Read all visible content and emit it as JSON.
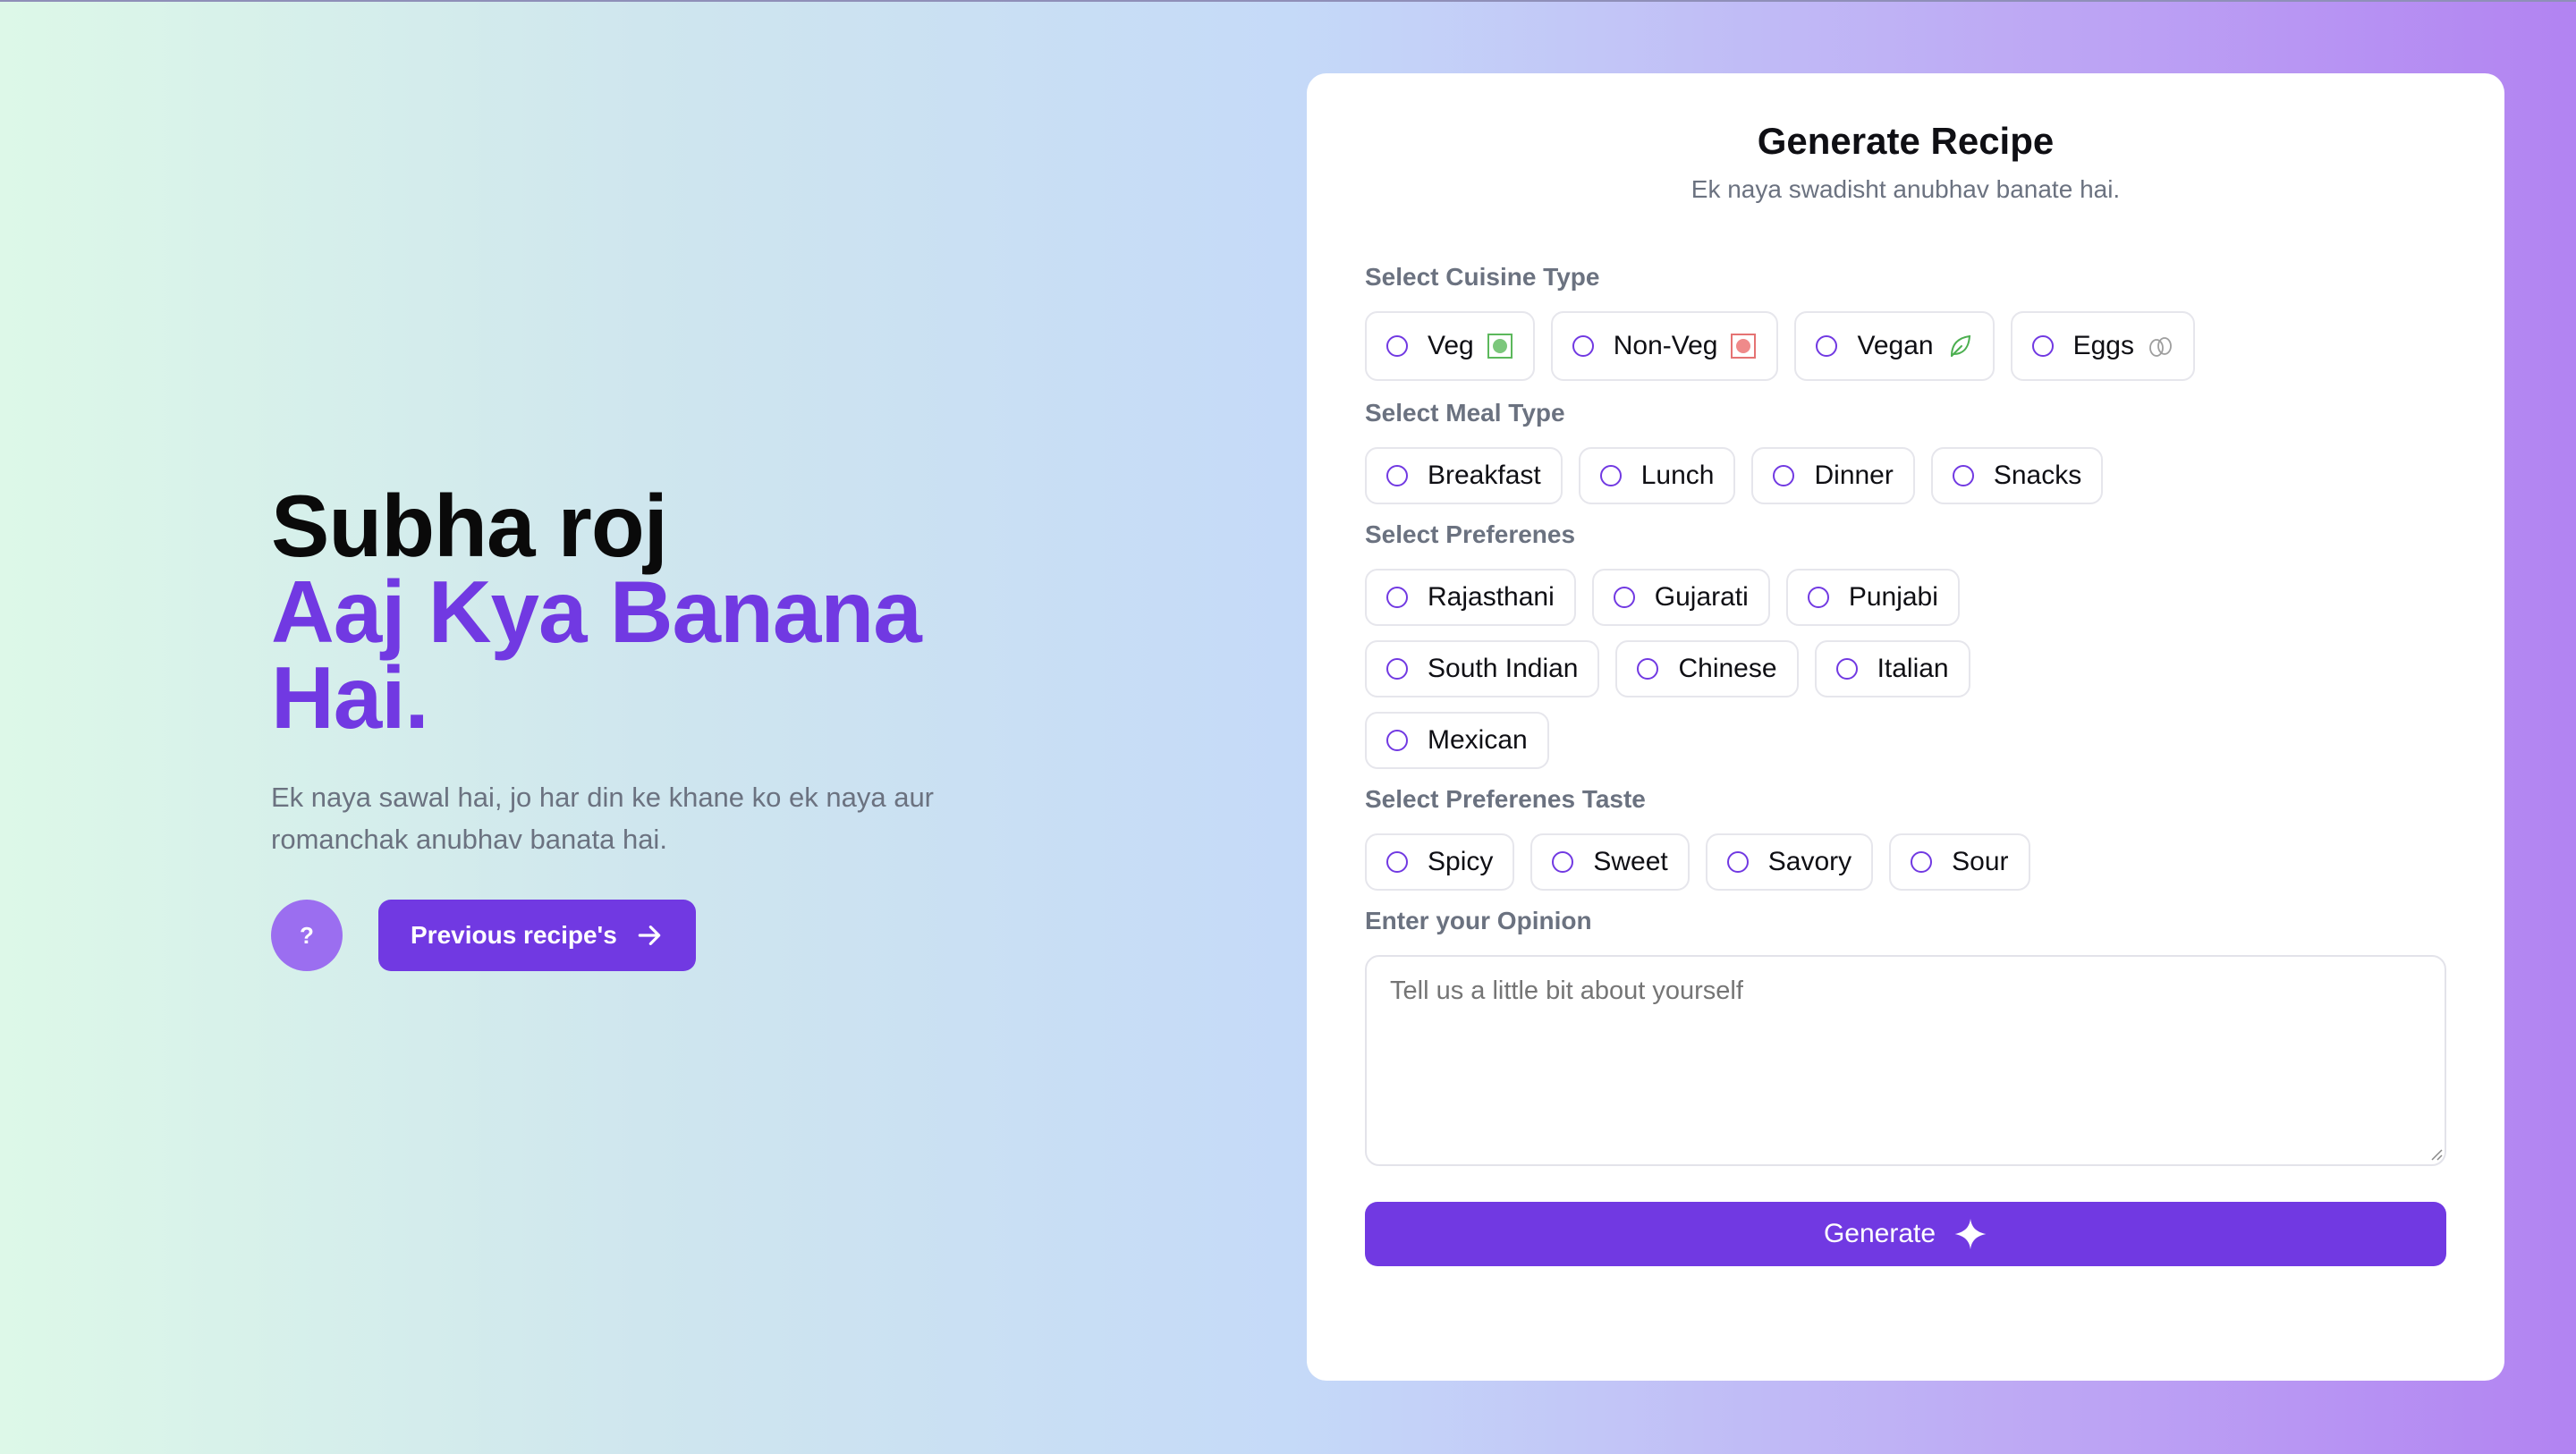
{
  "hero": {
    "line1": "Subha roj",
    "line2": "Aaj Kya Banana",
    "line3": "Hai.",
    "description": "Ek naya sawal hai, jo har din ke khane ko ek naya aur romanchak anubhav banata hai.",
    "help_label": "?",
    "prev_label": "Previous recipe's"
  },
  "card": {
    "title": "Generate Recipe",
    "subtitle": "Ek naya swadisht anubhav banate hai.",
    "cuisine_label": "Select Cuisine Type",
    "cuisine": [
      "Veg",
      "Non-Veg",
      "Vegan",
      "Eggs"
    ],
    "meal_label": "Select Meal Type",
    "meal": [
      "Breakfast",
      "Lunch",
      "Dinner",
      "Snacks"
    ],
    "pref_label": "Select Preferenes",
    "pref_row1": [
      "Rajasthani",
      "Gujarati",
      "Punjabi"
    ],
    "pref_row2": [
      "South Indian",
      "Chinese",
      "Italian"
    ],
    "pref_row3": [
      "Mexican"
    ],
    "taste_label": "Select Preferenes Taste",
    "taste": [
      "Spicy",
      "Sweet",
      "Savory",
      "Sour"
    ],
    "opinion_label": "Enter your Opinion",
    "opinion_placeholder": "Tell us a little bit about yourself",
    "generate_label": "Generate"
  },
  "icons": {
    "veg": "veg-square-icon",
    "nonveg": "nonveg-square-icon",
    "vegan": "leaf-icon",
    "eggs": "eggs-icon",
    "arrow": "arrow-right-icon",
    "sparkle": "sparkle-icon"
  },
  "colors": {
    "accent": "#7139e2",
    "help_button": "#9b6ef0",
    "veg": "#5cb85c",
    "nonveg": "#e57373"
  }
}
